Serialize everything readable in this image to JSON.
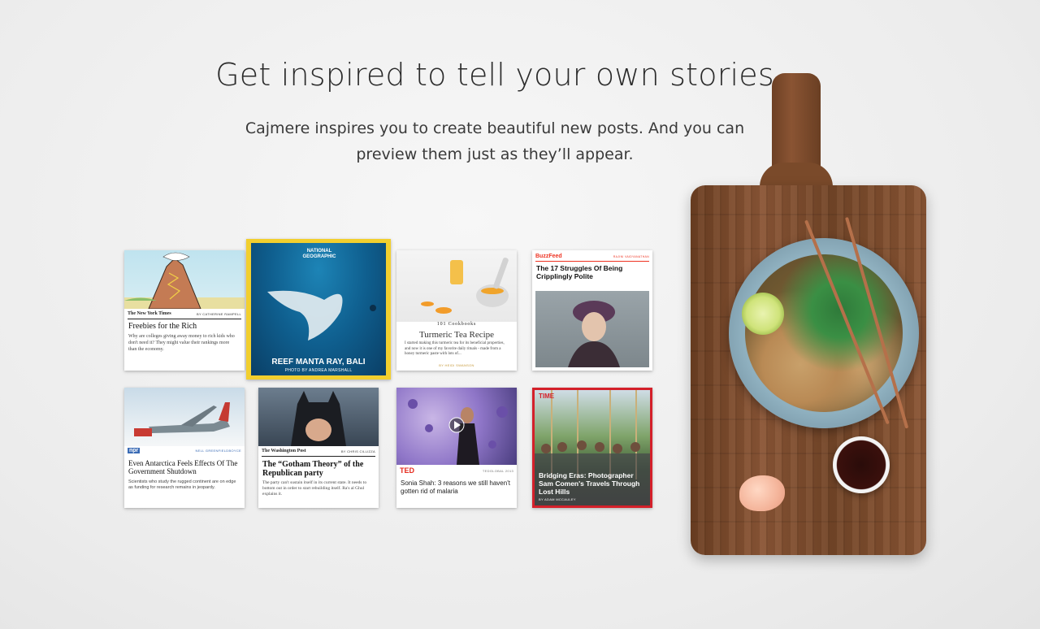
{
  "hero": {
    "title": "Get inspired to tell your own stories",
    "subtitle": "Cajmere inspires you to create beautiful new posts. And you can preview them just as they’ll appear."
  },
  "cards": {
    "nyt": {
      "publisher": "The New York Times",
      "byline": "BY CATHERINE RAMPELL",
      "headline": "Freebies for the Rich",
      "excerpt": "Why are colleges giving away money to rich kids who don't need it? They might value their rankings more than the economy."
    },
    "natgeo": {
      "publisher": "NATIONAL GEOGRAPHIC",
      "headline": "REEF MANTA RAY, BALI",
      "credit": "PHOTO BY ANDREA MARSHALL"
    },
    "cookbooks": {
      "publisher": "101 Cookbooks",
      "headline": "Turmeric Tea Recipe",
      "excerpt": "I started making this turmeric tea for its beneficial properties, and now it is one of my favorite daily rituals - made from a honey turmeric paste with lots of...",
      "byline": "BY HEIDI SWANSON"
    },
    "buzzfeed": {
      "publisher": "BuzzFeed",
      "byline": "RAJINI VAIDYANATHAN",
      "headline": "The 17 Struggles Of Being Cripplingly Polite"
    },
    "npr": {
      "publisher": "npr",
      "byline": "NELL GREENFIELDBOYCE",
      "headline": "Even Antarctica Feels Effects Of The Government Shutdown",
      "excerpt": "Scientists who study the rugged continent are on edge as funding for research remains in jeopardy."
    },
    "wapo": {
      "publisher": "The Washington Post",
      "byline": "BY CHRIS CILLIZZA",
      "headline": "The “Gotham Theory” of the Republican party",
      "excerpt": "The party can't sustain itself in its current state. It needs to bottom out in order to start rebuilding itself. Ra's al Ghul explains it."
    },
    "ted": {
      "publisher": "TED",
      "event": "TEDGLOBAL 2013",
      "headline": "Sonia Shah: 3 reasons we still haven't gotten rid of malaria"
    },
    "time": {
      "publisher": "TIME",
      "headline": "Bridging Eras: Photographer Sam Comen's Travels Through Lost Hills",
      "byline": "BY ADAM MCCAULEY"
    }
  },
  "colors": {
    "selected_border": "#f2cf2e",
    "time_red": "#d4202a",
    "ted_red": "#e62b1e",
    "buzzfeed_red": "#ee3322",
    "npr_blue": "#3a6bb5"
  }
}
